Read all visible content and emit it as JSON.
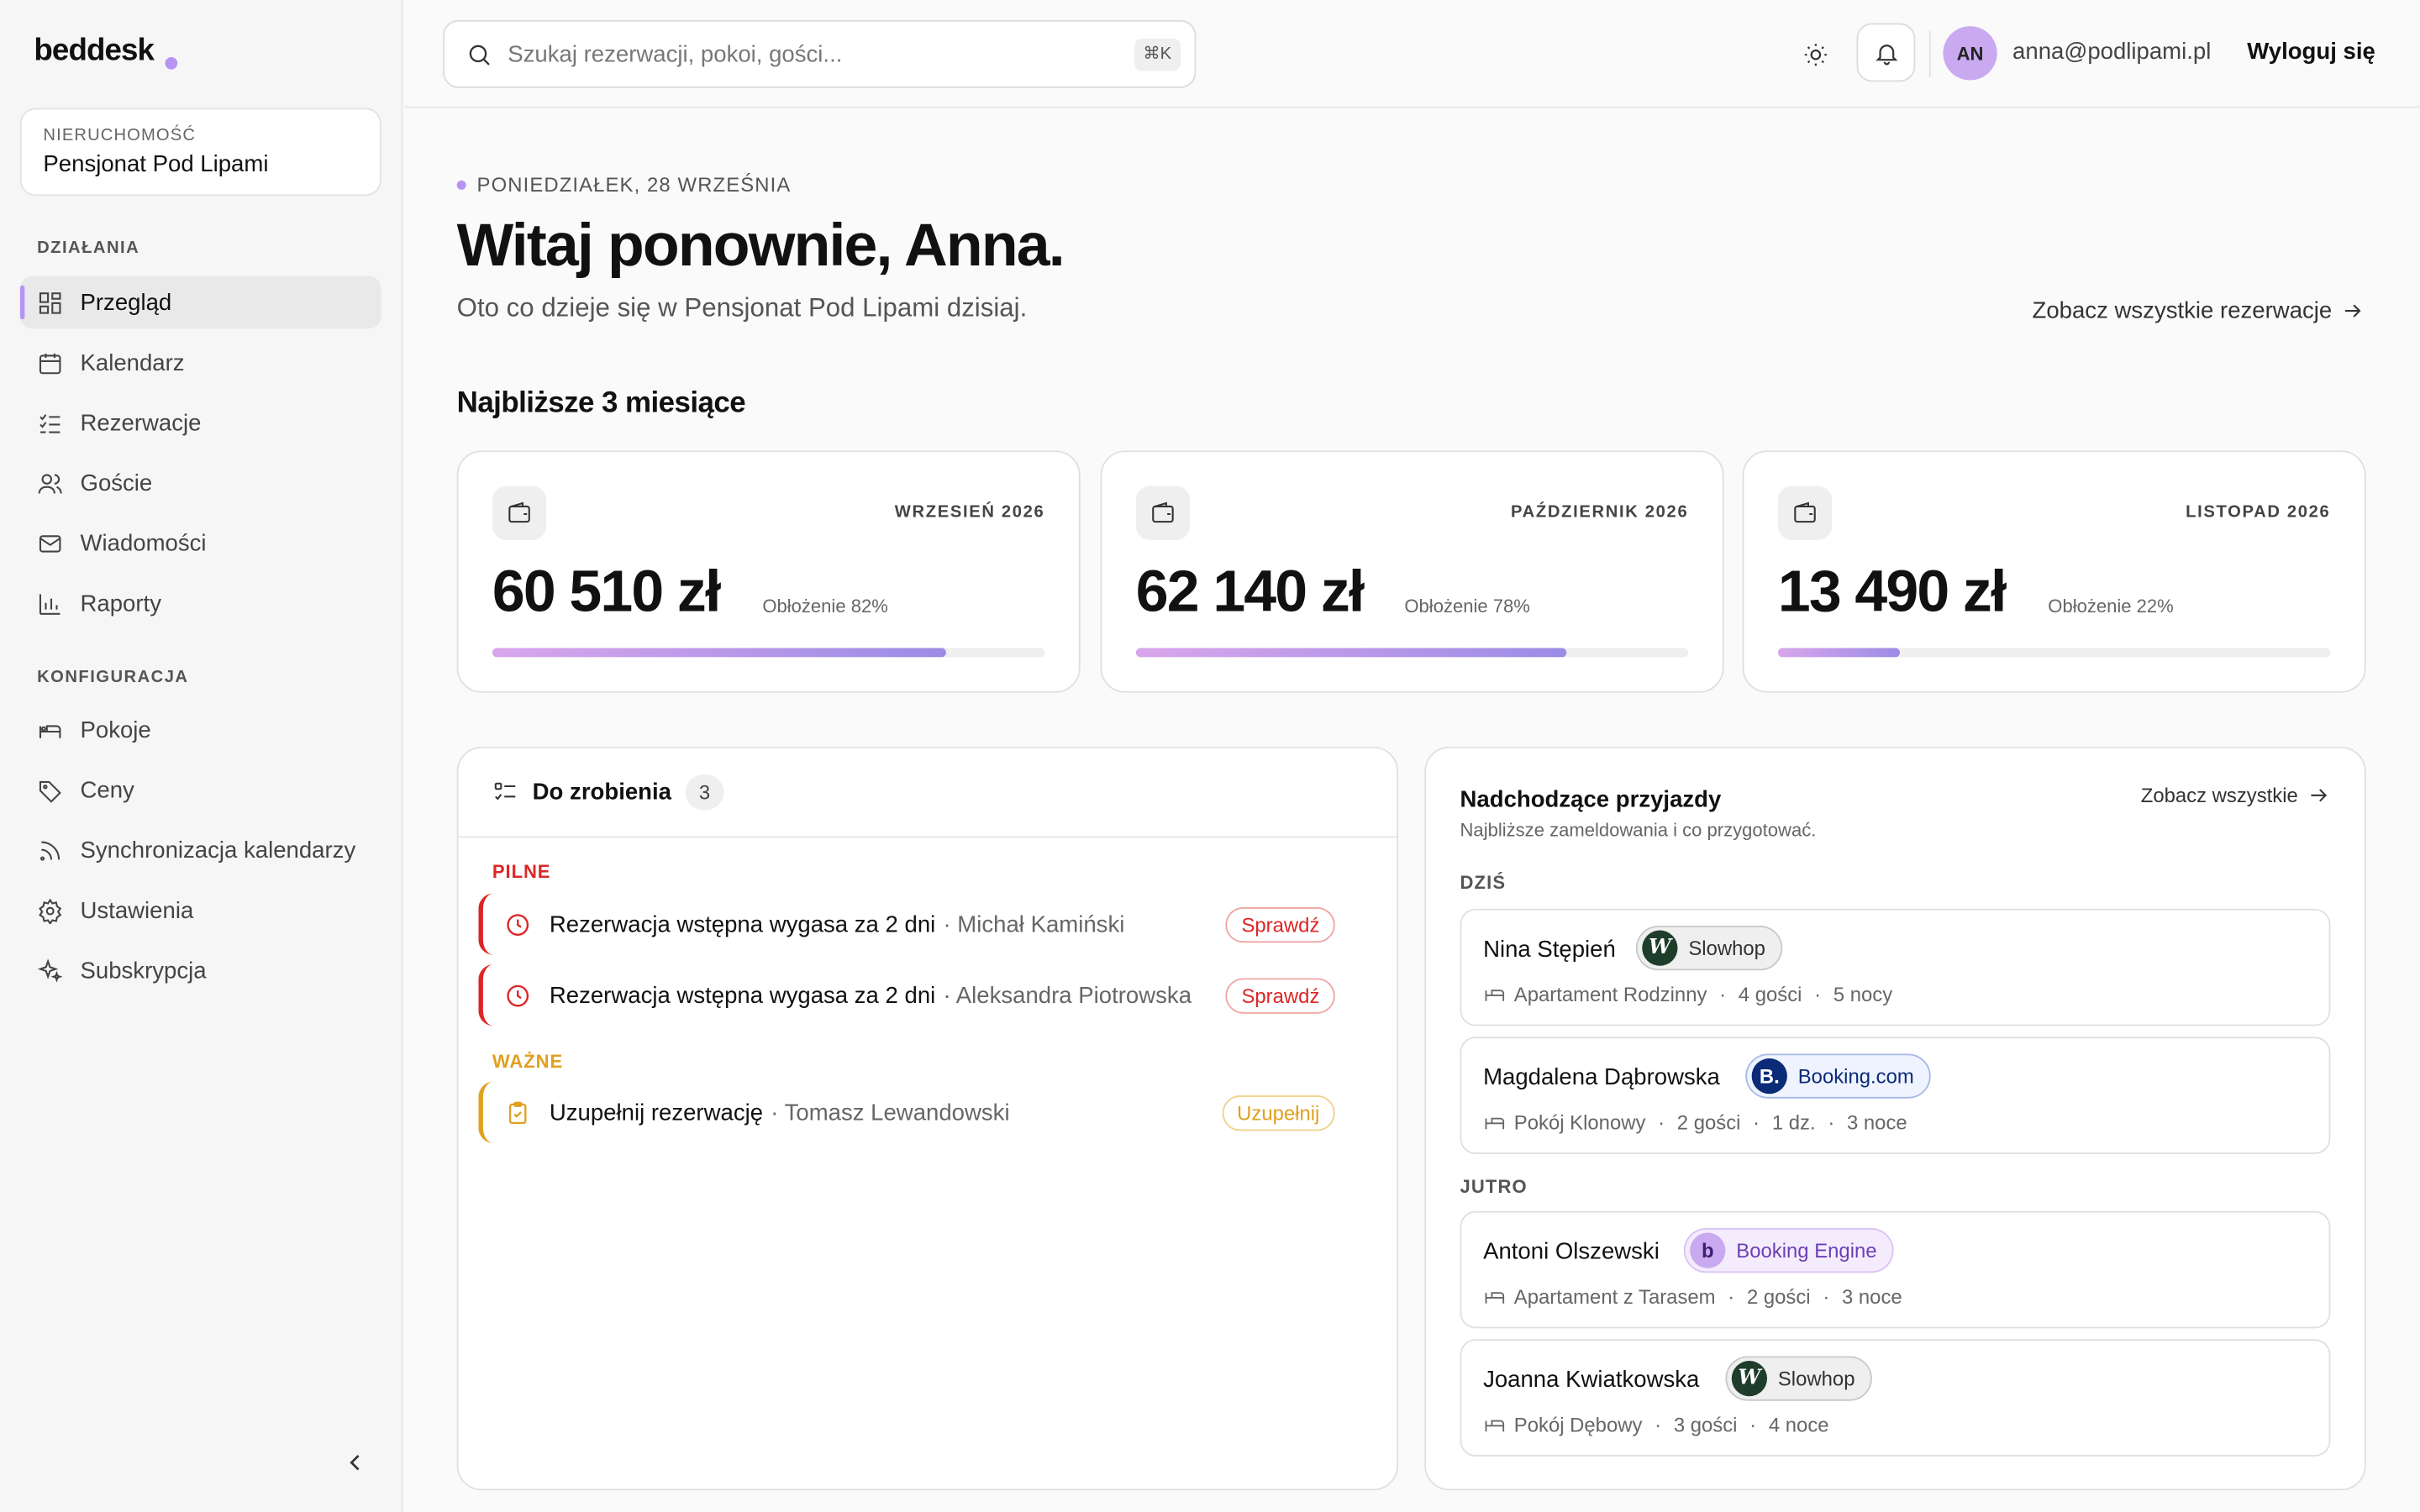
{
  "app": {
    "name": "beddesk"
  },
  "property": {
    "label": "NIERUCHOMOŚĆ",
    "name": "Pensjonat Pod Lipami"
  },
  "sidebar": {
    "sections": [
      {
        "title": "DZIAŁANIA",
        "items": [
          {
            "label": "Przegląd",
            "icon": "grid-icon",
            "active": true
          },
          {
            "label": "Kalendarz",
            "icon": "calendar-icon"
          },
          {
            "label": "Rezerwacje",
            "icon": "list-check-icon"
          },
          {
            "label": "Goście",
            "icon": "users-icon"
          },
          {
            "label": "Wiadomości",
            "icon": "mail-icon"
          },
          {
            "label": "Raporty",
            "icon": "bar-chart-icon"
          }
        ]
      },
      {
        "title": "KONFIGURACJA",
        "items": [
          {
            "label": "Pokoje",
            "icon": "bed-icon"
          },
          {
            "label": "Ceny",
            "icon": "tag-icon"
          },
          {
            "label": "Synchronizacja kalendarzy",
            "icon": "rss-icon"
          },
          {
            "label": "Ustawienia",
            "icon": "gear-icon"
          },
          {
            "label": "Subskrypcja",
            "icon": "sparkle-icon"
          }
        ]
      }
    ]
  },
  "topbar": {
    "search_placeholder": "Szukaj rezerwacji, pokoi, gości...",
    "shortcut": "⌘K",
    "user_initials": "AN",
    "user_email": "anna@podlipami.pl",
    "logout_label": "Wyloguj się"
  },
  "header": {
    "date": "PONIEDZIAŁEK, 28 WRZEŚNIA",
    "greeting": "Witaj ponownie, Anna.",
    "subtitle": "Oto co dzieje się w Pensjonat Pod Lipami dzisiaj.",
    "see_all_reservations": "Zobacz wszystkie rezerwacje"
  },
  "months_section": {
    "title": "Najbliższe 3 miesiące",
    "months": [
      {
        "label": "WRZESIEŃ 2026",
        "amount": "60 510 zł",
        "occupancy_label": "Obłożenie 82%",
        "occupancy": 0.82
      },
      {
        "label": "PAŹDZIERNIK 2026",
        "amount": "62 140 zł",
        "occupancy_label": "Obłożenie 78%",
        "occupancy": 0.78
      },
      {
        "label": "LISTOPAD 2026",
        "amount": "13 490 zł",
        "occupancy_label": "Obłożenie 22%",
        "occupancy": 0.22
      }
    ]
  },
  "todo": {
    "title": "Do zrobienia",
    "count": "3",
    "urgent_label": "PILNE",
    "important_label": "WAŻNE",
    "tasks": [
      {
        "text": "Rezerwacja wstępna wygasa za 2 dni",
        "guest": "· Michał Kamiński",
        "action": "Sprawdź"
      },
      {
        "text": "Rezerwacja wstępna wygasa za 2 dni",
        "guest": "· Aleksandra Piotrowska",
        "action": "Sprawdź"
      },
      {
        "text": "Uzupełnij rezerwację",
        "guest": "· Tomasz Lewandowski",
        "action": "Uzupełnij"
      }
    ],
    "colors": {
      "urgent": "#dc2626",
      "important": "#e0a020"
    }
  },
  "arrivals": {
    "title": "Nadchodzące przyjazdy",
    "subtitle": "Najbliższe zameldowania i co przygotować.",
    "see_all": "Zobacz wszystkie",
    "today_label": "DZIŚ",
    "tomorrow_label": "JUTRO",
    "items": [
      {
        "name": "Nina Stępień",
        "channel": "Slowhop",
        "channel_mark": "W",
        "room": "Apartament Rodzinny",
        "guests": "4 gości",
        "extra": "",
        "nights": "5 nocy"
      },
      {
        "name": "Magdalena Dąbrowska",
        "channel": "Booking.com",
        "channel_mark": "B.",
        "room": "Pokój Klonowy",
        "guests": "2 gości",
        "extra": "1 dz.",
        "nights": "3 noce"
      },
      {
        "name": "Antoni Olszewski",
        "channel": "Booking Engine",
        "channel_mark": "b",
        "room": "Apartament z Tarasem",
        "guests": "2 gości",
        "extra": "",
        "nights": "3 noce"
      },
      {
        "name": "Joanna Kwiatkowska",
        "channel": "Slowhop",
        "channel_mark": "W",
        "room": "Pokój Dębowy",
        "guests": "3 gości",
        "extra": "",
        "nights": "4 noce"
      }
    ]
  },
  "colors": {
    "accent": "#b794f4",
    "bar_start": "#d9a6ec",
    "bar_end": "#9b8ce6"
  }
}
